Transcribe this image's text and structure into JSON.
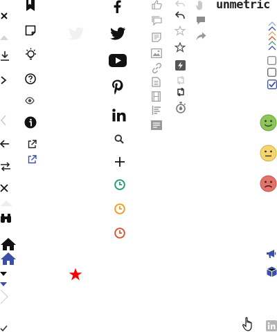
{
  "brand": {
    "wordmark": "unmetric"
  },
  "icons": {
    "col1": [
      "close-icon",
      "triangle-up-icon",
      "download-icon",
      "chevron-right-icon",
      "chevron-left-icon",
      "arrow-left-icon",
      "swap-arrows-icon",
      "close-icon",
      "triangle-up-icon",
      "binoculars-icon",
      "home-icon",
      "home-icon",
      "caret-down-icon",
      "chevron-right-icon",
      "check-icon"
    ],
    "col2": [
      "bookmark-icon",
      "sticky-note-icon",
      "lightbulb-icon",
      "help-circle-icon",
      "eye-icon",
      "info-icon",
      "external-link-icon",
      "external-link-icon"
    ],
    "col3": [
      "twitter-icon",
      "red-star-icon"
    ],
    "col4": [
      "facebook-icon",
      "twitter-icon",
      "youtube-icon",
      "pinterest-icon",
      "linkedin-icon",
      "search-icon",
      "plus-icon",
      "clock-icon",
      "clock-icon",
      "clock-icon"
    ],
    "col5": [
      "thumbs-up-icon",
      "comment-icon",
      "document-icon",
      "image-icon",
      "link-icon",
      "file-icon",
      "film-icon",
      "align-left-icon",
      "text-block-icon"
    ],
    "col6": [
      "reply-icon",
      "reply-icon",
      "star-outline-icon",
      "star-outline-icon",
      "bolt-icon",
      "retweet-icon",
      "retweet-icon",
      "stopwatch-icon"
    ],
    "col7": [
      "hand-icon",
      "comment-icon",
      "share-icon"
    ],
    "col8": [
      "chevrons-up-icon",
      "checkbox-icon",
      "checkbox-icon",
      "checkbox-checked-icon",
      "smiley-happy-icon",
      "smiley-neutral-icon",
      "smiley-sad-icon",
      "megaphone-icon",
      "cube-icon",
      "linkedin-icon",
      "hand-pointer-icon"
    ]
  },
  "colors": {
    "dark": "#111111",
    "gray": "#9a9a9a",
    "light_gray": "#cfcfcf",
    "blue": "#3b4fa8",
    "green": "#1e9b6e",
    "orange": "#f39a1e",
    "red_orange": "#d9532c",
    "red": "#ff0000",
    "smile_green": "#8dc55a",
    "smile_yellow": "#f5d56d",
    "smile_red": "#e3736a"
  }
}
